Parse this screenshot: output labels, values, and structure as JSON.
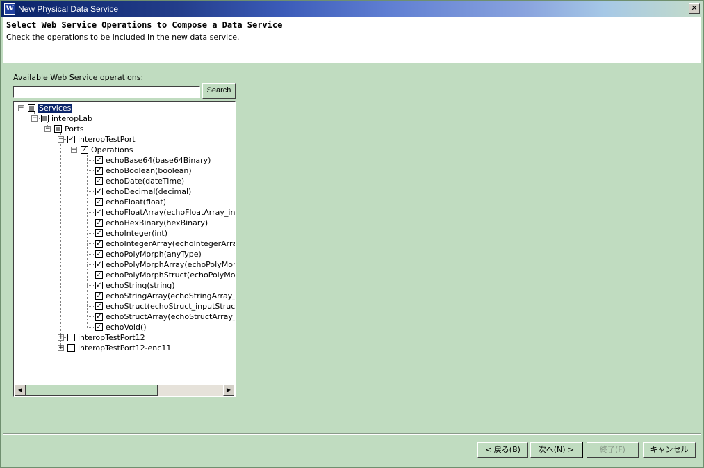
{
  "window": {
    "title": "New Physical Data Service",
    "close_symbol": "✕"
  },
  "header": {
    "title": "Select Web Service Operations to Compose a Data Service",
    "description": "Check the operations to be included in the new data service."
  },
  "available_label": "Available Web Service operations:",
  "search": {
    "value": "",
    "button_label": "Search"
  },
  "tree": {
    "services": "Services",
    "interop_lab": "interopLab",
    "ports": "Ports",
    "interop_test_port": "interopTestPort",
    "operations_label": "Operations",
    "operations": [
      "echoBase64(base64Binary)",
      "echoBoolean(boolean)",
      "echoDate(dateTime)",
      "echoDecimal(decimal)",
      "echoFloat(float)",
      "echoFloatArray(echoFloatArray_inpu",
      "echoHexBinary(hexBinary)",
      "echoInteger(int)",
      "echoIntegerArray(echoIntegerArray_i",
      "echoPolyMorph(anyType)",
      "echoPolyMorphArray(echoPolyMorph",
      "echoPolyMorphStruct(echoPolyMorph",
      "echoString(string)",
      "echoStringArray(echoStringArray_inp",
      "echoStruct(echoStruct_inputStruct)",
      "echoStructArray(echoStructArray_inp",
      "echoVoid()"
    ],
    "interop_test_port12": "interopTestPort12",
    "interop_test_port12_enc11": "interopTestPort12-enc11",
    "check_mark": "✓",
    "minus_symbol": "−",
    "plus_symbol": "+"
  },
  "scrollbar": {
    "left_arrow": "◀",
    "right_arrow": "▶"
  },
  "buttons": {
    "back": "< 戻る(B)",
    "next": "次へ(N) >",
    "finish": "終了(F)",
    "cancel": "キャンセル"
  }
}
